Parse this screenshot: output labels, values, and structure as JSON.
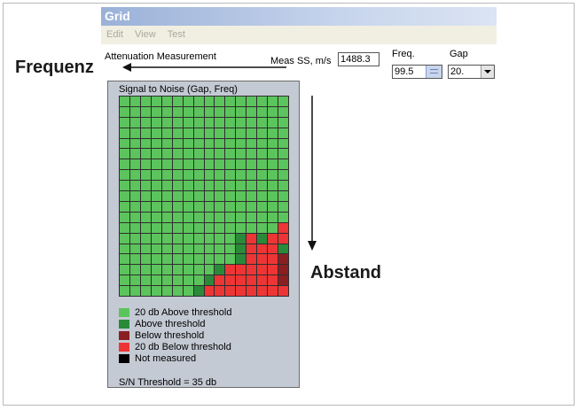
{
  "window": {
    "title": "Grid"
  },
  "menu": [
    "Edit",
    "View",
    "Test"
  ],
  "toolbar": {
    "attenuation_label": "Attenuation Measurement",
    "meas_ss_label": "Meas SS, m/s",
    "meas_ss_value": "1488.3",
    "freq_label": "Freq.",
    "freq_value": "99.5",
    "gap_label": "Gap",
    "gap_value": "20."
  },
  "panel": {
    "title": "Signal to Noise (Gap, Freq)",
    "threshold_text": "S/N Threshold = 35 db"
  },
  "legend": [
    {
      "label": "20 db Above threshold",
      "color": "#5cc45c"
    },
    {
      "label": "Above threshold",
      "color": "#2a8a3a"
    },
    {
      "label": "Below threshold",
      "color": "#8a1f22"
    },
    {
      "label": "20 db Below threshold",
      "color": "#ee3535"
    },
    {
      "label": "Not measured",
      "color": "#000000"
    }
  ],
  "grid": {
    "columns": 16,
    "rows": 19,
    "cells": {
      "20 db Below threshold": [
        [
          15,
          14
        ],
        [
          16,
          14
        ],
        [
          15,
          15
        ],
        [
          16,
          15
        ],
        [
          17,
          15
        ],
        [
          13,
          12
        ],
        [
          14,
          12
        ],
        [
          15,
          12
        ],
        [
          16,
          12
        ],
        [
          17,
          12
        ],
        [
          18,
          12
        ],
        [
          14,
          13
        ],
        [
          15,
          13
        ],
        [
          16,
          13
        ],
        [
          17,
          13
        ],
        [
          18,
          13
        ],
        [
          16,
          10
        ],
        [
          17,
          10
        ],
        [
          18,
          10
        ],
        [
          16,
          11
        ],
        [
          17,
          11
        ],
        [
          18,
          11
        ],
        [
          17,
          9
        ],
        [
          18,
          9
        ],
        [
          18,
          8
        ],
        [
          18,
          15
        ],
        [
          18,
          14
        ],
        [
          17,
          14
        ]
      ],
      "Above threshold": [
        [
          15,
          11
        ],
        [
          14,
          11
        ],
        [
          13,
          11
        ],
        [
          14,
          15
        ],
        [
          13,
          13
        ],
        [
          16,
          9
        ],
        [
          17,
          8
        ],
        [
          18,
          7
        ]
      ],
      "Below threshold": [
        [
          16,
          15
        ],
        [
          17,
          15
        ],
        [
          15,
          15
        ]
      ]
    }
  },
  "annotations": {
    "frequenz": "Frequenz",
    "abstand": "Abstand"
  }
}
